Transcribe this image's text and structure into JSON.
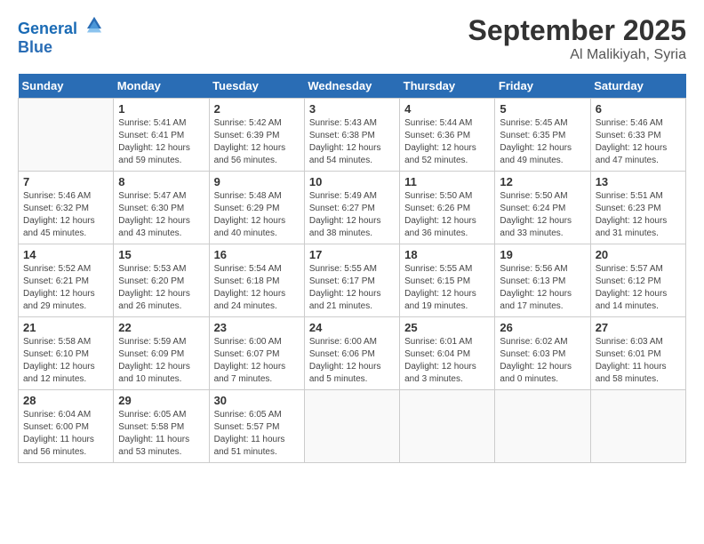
{
  "header": {
    "logo_line1": "General",
    "logo_line2": "Blue",
    "month": "September 2025",
    "location": "Al Malikiyah, Syria"
  },
  "weekdays": [
    "Sunday",
    "Monday",
    "Tuesday",
    "Wednesday",
    "Thursday",
    "Friday",
    "Saturday"
  ],
  "weeks": [
    [
      {
        "day": "",
        "info": ""
      },
      {
        "day": "1",
        "info": "Sunrise: 5:41 AM\nSunset: 6:41 PM\nDaylight: 12 hours\nand 59 minutes."
      },
      {
        "day": "2",
        "info": "Sunrise: 5:42 AM\nSunset: 6:39 PM\nDaylight: 12 hours\nand 56 minutes."
      },
      {
        "day": "3",
        "info": "Sunrise: 5:43 AM\nSunset: 6:38 PM\nDaylight: 12 hours\nand 54 minutes."
      },
      {
        "day": "4",
        "info": "Sunrise: 5:44 AM\nSunset: 6:36 PM\nDaylight: 12 hours\nand 52 minutes."
      },
      {
        "day": "5",
        "info": "Sunrise: 5:45 AM\nSunset: 6:35 PM\nDaylight: 12 hours\nand 49 minutes."
      },
      {
        "day": "6",
        "info": "Sunrise: 5:46 AM\nSunset: 6:33 PM\nDaylight: 12 hours\nand 47 minutes."
      }
    ],
    [
      {
        "day": "7",
        "info": "Sunrise: 5:46 AM\nSunset: 6:32 PM\nDaylight: 12 hours\nand 45 minutes."
      },
      {
        "day": "8",
        "info": "Sunrise: 5:47 AM\nSunset: 6:30 PM\nDaylight: 12 hours\nand 43 minutes."
      },
      {
        "day": "9",
        "info": "Sunrise: 5:48 AM\nSunset: 6:29 PM\nDaylight: 12 hours\nand 40 minutes."
      },
      {
        "day": "10",
        "info": "Sunrise: 5:49 AM\nSunset: 6:27 PM\nDaylight: 12 hours\nand 38 minutes."
      },
      {
        "day": "11",
        "info": "Sunrise: 5:50 AM\nSunset: 6:26 PM\nDaylight: 12 hours\nand 36 minutes."
      },
      {
        "day": "12",
        "info": "Sunrise: 5:50 AM\nSunset: 6:24 PM\nDaylight: 12 hours\nand 33 minutes."
      },
      {
        "day": "13",
        "info": "Sunrise: 5:51 AM\nSunset: 6:23 PM\nDaylight: 12 hours\nand 31 minutes."
      }
    ],
    [
      {
        "day": "14",
        "info": "Sunrise: 5:52 AM\nSunset: 6:21 PM\nDaylight: 12 hours\nand 29 minutes."
      },
      {
        "day": "15",
        "info": "Sunrise: 5:53 AM\nSunset: 6:20 PM\nDaylight: 12 hours\nand 26 minutes."
      },
      {
        "day": "16",
        "info": "Sunrise: 5:54 AM\nSunset: 6:18 PM\nDaylight: 12 hours\nand 24 minutes."
      },
      {
        "day": "17",
        "info": "Sunrise: 5:55 AM\nSunset: 6:17 PM\nDaylight: 12 hours\nand 21 minutes."
      },
      {
        "day": "18",
        "info": "Sunrise: 5:55 AM\nSunset: 6:15 PM\nDaylight: 12 hours\nand 19 minutes."
      },
      {
        "day": "19",
        "info": "Sunrise: 5:56 AM\nSunset: 6:13 PM\nDaylight: 12 hours\nand 17 minutes."
      },
      {
        "day": "20",
        "info": "Sunrise: 5:57 AM\nSunset: 6:12 PM\nDaylight: 12 hours\nand 14 minutes."
      }
    ],
    [
      {
        "day": "21",
        "info": "Sunrise: 5:58 AM\nSunset: 6:10 PM\nDaylight: 12 hours\nand 12 minutes."
      },
      {
        "day": "22",
        "info": "Sunrise: 5:59 AM\nSunset: 6:09 PM\nDaylight: 12 hours\nand 10 minutes."
      },
      {
        "day": "23",
        "info": "Sunrise: 6:00 AM\nSunset: 6:07 PM\nDaylight: 12 hours\nand 7 minutes."
      },
      {
        "day": "24",
        "info": "Sunrise: 6:00 AM\nSunset: 6:06 PM\nDaylight: 12 hours\nand 5 minutes."
      },
      {
        "day": "25",
        "info": "Sunrise: 6:01 AM\nSunset: 6:04 PM\nDaylight: 12 hours\nand 3 minutes."
      },
      {
        "day": "26",
        "info": "Sunrise: 6:02 AM\nSunset: 6:03 PM\nDaylight: 12 hours\nand 0 minutes."
      },
      {
        "day": "27",
        "info": "Sunrise: 6:03 AM\nSunset: 6:01 PM\nDaylight: 11 hours\nand 58 minutes."
      }
    ],
    [
      {
        "day": "28",
        "info": "Sunrise: 6:04 AM\nSunset: 6:00 PM\nDaylight: 11 hours\nand 56 minutes."
      },
      {
        "day": "29",
        "info": "Sunrise: 6:05 AM\nSunset: 5:58 PM\nDaylight: 11 hours\nand 53 minutes."
      },
      {
        "day": "30",
        "info": "Sunrise: 6:05 AM\nSunset: 5:57 PM\nDaylight: 11 hours\nand 51 minutes."
      },
      {
        "day": "",
        "info": ""
      },
      {
        "day": "",
        "info": ""
      },
      {
        "day": "",
        "info": ""
      },
      {
        "day": "",
        "info": ""
      }
    ]
  ]
}
